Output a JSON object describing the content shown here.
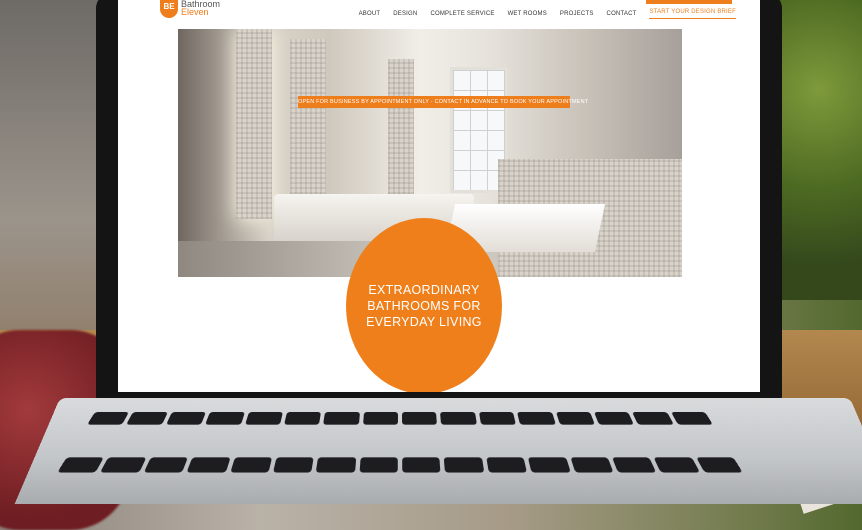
{
  "site": {
    "logo": {
      "mark": "BE",
      "line1": "Bathroom",
      "line2": "Eleven"
    },
    "nav": {
      "items": [
        {
          "label": "ABOUT"
        },
        {
          "label": "DESIGN"
        },
        {
          "label": "COMPLETE SERVICE"
        },
        {
          "label": "WET ROOMS"
        },
        {
          "label": "PROJECTS"
        },
        {
          "label": "CONTACT"
        }
      ],
      "cta_label": "START YOUR DESIGN BRIEF"
    },
    "hero": {
      "banner": "OPEN FOR BUSINESS BY APPOINTMENT ONLY - CONTACT IN ADVANCE TO BOOK YOUR APPOINTMENT"
    },
    "tagline": {
      "line1": "EXTRAORDINARY",
      "line2": "BATHROOMS FOR",
      "line3": "EVERYDAY LIVING"
    }
  },
  "colors": {
    "brand_orange": "#ee7d1b",
    "nav_text": "#333333"
  }
}
